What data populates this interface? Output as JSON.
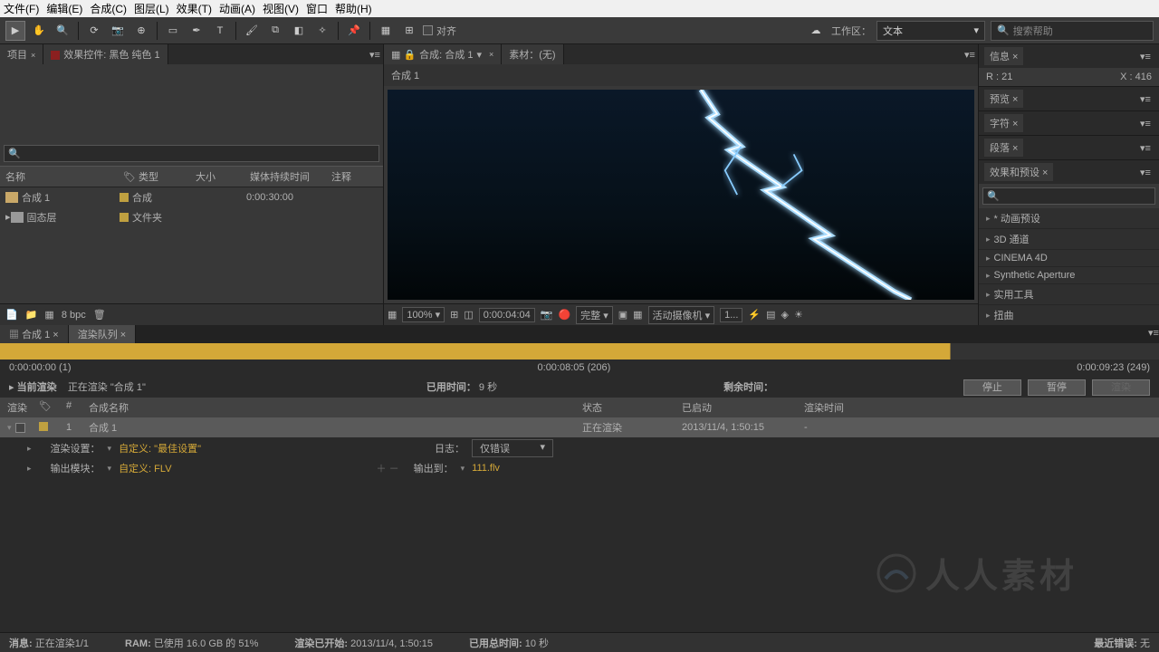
{
  "menu": {
    "file": "文件(F)",
    "edit": "编辑(E)",
    "comp": "合成(C)",
    "layer": "图层(L)",
    "effect": "效果(T)",
    "anim": "动画(A)",
    "view": "视图(V)",
    "window": "窗口",
    "help": "帮助(H)"
  },
  "toolbar": {
    "align": "对齐",
    "workspace_label": "工作区：",
    "workspace_value": "文本",
    "search_placeholder": "搜索帮助"
  },
  "project": {
    "tab1": "项目",
    "tab2": "效果控件: 黑色 纯色 1",
    "hdr_name": "名称",
    "hdr_type": "类型",
    "hdr_size": "大小",
    "hdr_duration": "媒体持续时间",
    "hdr_comment": "注释",
    "row1_name": "合成 1",
    "row1_type": "合成",
    "row1_dur": "0:00:30:00",
    "row2_name": "固态层",
    "row2_type": "文件夹",
    "bpc": "8 bpc"
  },
  "comp": {
    "tab": "合成: 合成 1",
    "footage_tab": "素材：(无)",
    "crumb": "合成 1",
    "zoom": "100%",
    "time": "0:00:04:04",
    "res": "完整",
    "camera": "活动摄像机",
    "view": "1..."
  },
  "right": {
    "info": "信息",
    "info_r": "R : 21",
    "info_x": "X : 416",
    "preview": "预览",
    "char": "字符",
    "para": "段落",
    "effects": "效果和预设",
    "eff1": "* 动画预设",
    "eff2": "3D 通道",
    "eff3": "CINEMA 4D",
    "eff4": "Synthetic Aperture",
    "eff5": "实用工具",
    "eff6": "扭曲"
  },
  "bottom": {
    "tab1": "合成 1",
    "tab2": "渲染队列",
    "t_start": "0:00:00:00 (1)",
    "t_mid": "0:00:08:05 (206)",
    "t_end": "0:00:09:23 (249)",
    "current": "当前渲染",
    "rendering": "正在渲染 \"合成 1\"",
    "elapsed_label": "已用时间：",
    "elapsed_val": "9 秒",
    "remain_label": "剩余时间：",
    "btn_stop": "停止",
    "btn_pause": "暂停",
    "btn_render": "渲染",
    "h_render": "渲染",
    "h_num": "#",
    "h_name": "合成名称",
    "h_status": "状态",
    "h_started": "已启动",
    "h_rtime": "渲染时间",
    "r1_num": "1",
    "r1_name": "合成 1",
    "r1_status": "正在渲染",
    "r1_started": "2013/11/4, 1:50:15",
    "r1_rtime": "-",
    "rs_label": "渲染设置：",
    "rs_val": "自定义: \"最佳设置\"",
    "log_label": "日志：",
    "log_val": "仅错误",
    "om_label": "输出模块：",
    "om_val": "自定义: FLV",
    "out_label": "输出到：",
    "out_val": "111.flv"
  },
  "status": {
    "msg_label": "消息:",
    "msg_val": "正在渲染1/1",
    "ram_label": "RAM:",
    "ram_val": "已使用 16.0 GB 的 51%",
    "start_label": "渲染已开始:",
    "start_val": "2013/11/4, 1:50:15",
    "total_label": "已用总时间:",
    "total_val": "10 秒",
    "err_label": "最近错误:",
    "err_val": "无"
  },
  "watermark": "人人素材"
}
